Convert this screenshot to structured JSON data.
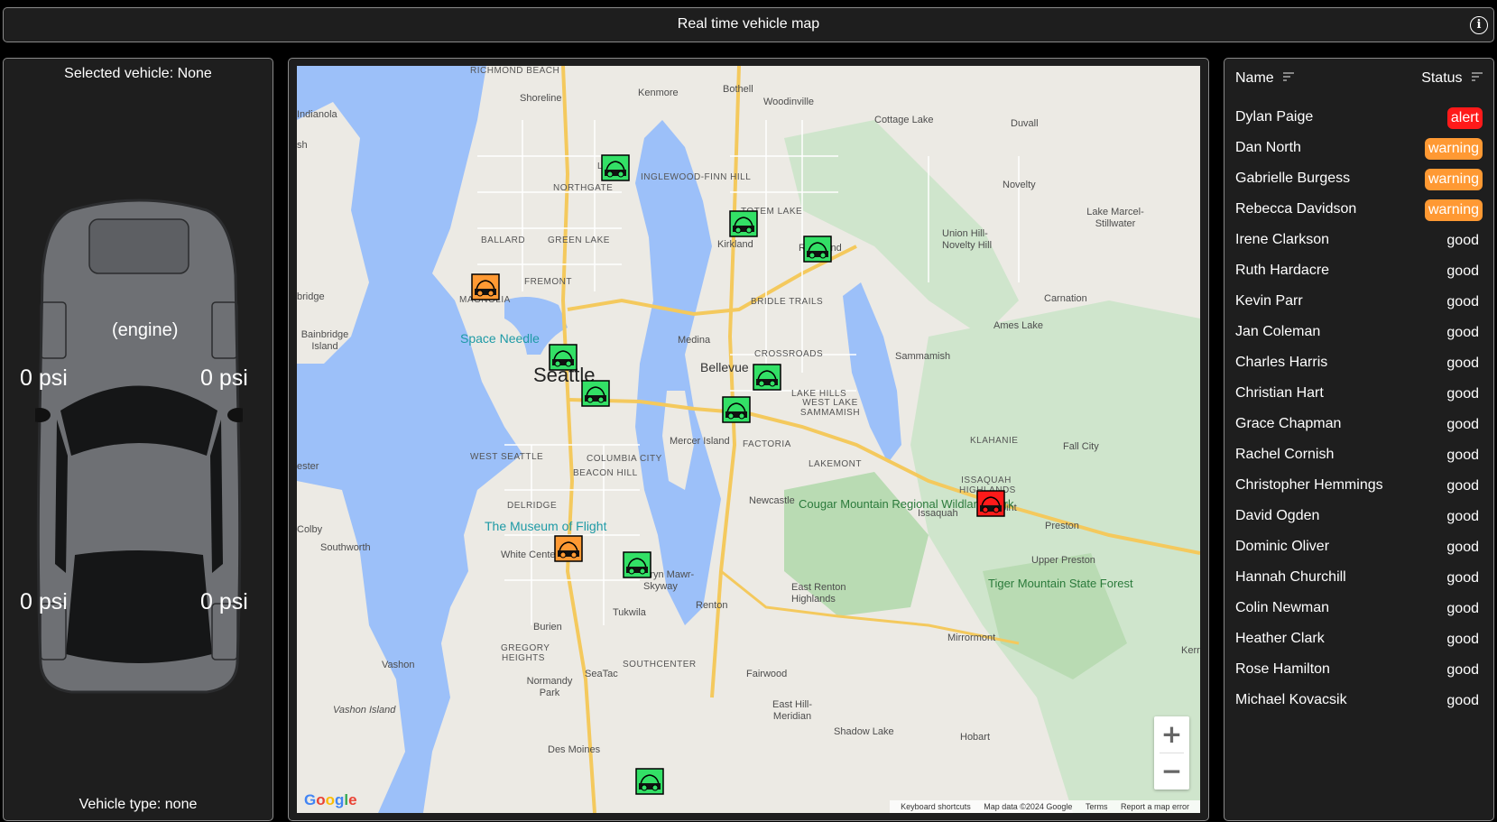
{
  "header": {
    "title": "Real time vehicle map",
    "info_label": "i"
  },
  "left_panel": {
    "selected_vehicle": "Selected vehicle: None",
    "engine_label": "(engine)",
    "tires": {
      "front_left": "0 psi",
      "front_right": "0 psi",
      "rear_left": "0 psi",
      "rear_right": "0 psi"
    },
    "vehicle_type": "Vehicle type: none"
  },
  "map": {
    "places": {
      "richmond_beach": "RICHMOND BEACH",
      "shoreline": "Shoreline",
      "kenmore": "Kenmore",
      "bothell": "Bothell",
      "woodinville": "Woodinville",
      "cottage_lake": "Cottage Lake",
      "duvall": "Duvall",
      "indianola": "Indianola",
      "lake_city": "LAKE",
      "northgate": "NORTHGATE",
      "inglewood": "INGLEWOOD-FINN HILL",
      "totem_lake": "TOTEM LAKE",
      "novelty": "Novelty",
      "kirkland": "Kirkland",
      "redmond": "Redmond",
      "union_hill": "Union Hill-Novelty Hill",
      "lake_marcel": "Lake Marcel-Stillwater",
      "ballard": "BALLARD",
      "green_lake": "GREEN LAKE",
      "fremont": "FREMONT",
      "magnolia": "MAGNOLIA",
      "bridle_trails": "BRIDLE TRAILS",
      "carnation": "Carnation",
      "bainbridge": "Bainbridge Island",
      "space_needle": "Space Needle",
      "medina": "Medina",
      "ames_lake": "Ames Lake",
      "sammamish": "Sammamish",
      "seattle": "Seattle",
      "bellevue": "Bellevue",
      "crossroads": "CROSSROADS",
      "lake_hills": "LAKE HILLS",
      "west_lake_sammamish": "WEST LAKE SAMMAMISH",
      "mercer_island": "Mercer Island",
      "factoria": "FACTORIA",
      "klahanie": "KLAHANIE",
      "fall_city": "Fall City",
      "west_seattle": "WEST SEATTLE",
      "columbia_city": "COLUMBIA CITY",
      "beacon_hill": "BEACON HILL",
      "lakemont": "LAKEMONT",
      "issaquah_highlands": "ISSAQUAH HIGHLANDS",
      "delridge": "DELRIDGE",
      "newcastle": "Newcastle",
      "issaquah": "Issaquah",
      "snoqualmie_point": "Point",
      "preston": "Preston",
      "museum_of_flight": "The Museum of Flight",
      "cougar_mountain": "Cougar Mountain Regional Wildland Park",
      "colby": "Colby",
      "southworth": "Southworth",
      "white_center": "White Center",
      "upper_preston": "Upper Preston",
      "bryn_mawr": "Bryn Mawr-Skyway",
      "renton": "Renton",
      "east_renton": "East Renton Highlands",
      "tiger_mountain": "Tiger Mountain State Forest",
      "burien": "Burien",
      "tukwila": "Tukwila",
      "gregory_heights": "GREGORY HEIGHTS",
      "mirrormont": "Mirrormont",
      "vashon": "Vashon",
      "southcenter": "SOUTHCENTER",
      "seatac": "SeaTac",
      "fairwood": "Fairwood",
      "normandy_park": "Normandy Park",
      "vashon_island": "Vashon Island",
      "east_hill": "East Hill-Meridian",
      "shadow_lake": "Shadow Lake",
      "hobart": "Hobart",
      "des_moines": "Des Moines",
      "bridge_island": "bridge",
      "ester": "ester",
      "sh": "sh",
      "kerris": "Kerris",
      "seattle_point": "oint"
    },
    "zoom_in": "+",
    "zoom_out": "−",
    "google_logo": "Google",
    "attribution": {
      "shortcuts": "Keyboard shortcuts",
      "data": "Map data ©2024 Google",
      "terms": "Terms",
      "report": "Report a map error"
    },
    "markers": [
      {
        "status": "good"
      },
      {
        "status": "good"
      },
      {
        "status": "good"
      },
      {
        "status": "warning"
      },
      {
        "status": "good"
      },
      {
        "status": "good"
      },
      {
        "status": "good"
      },
      {
        "status": "good"
      },
      {
        "status": "warning"
      },
      {
        "status": "good"
      },
      {
        "status": "alert"
      },
      {
        "status": "good"
      }
    ]
  },
  "vehicle_list": {
    "name_header": "Name",
    "status_header": "Status",
    "rows": [
      {
        "name": "Dylan Paige",
        "status": "alert"
      },
      {
        "name": "Dan North",
        "status": "warning"
      },
      {
        "name": "Gabrielle Burgess",
        "status": "warning"
      },
      {
        "name": "Rebecca Davidson",
        "status": "warning"
      },
      {
        "name": "Irene Clarkson",
        "status": "good"
      },
      {
        "name": "Ruth Hardacre",
        "status": "good"
      },
      {
        "name": "Kevin Parr",
        "status": "good"
      },
      {
        "name": "Jan Coleman",
        "status": "good"
      },
      {
        "name": "Charles Harris",
        "status": "good"
      },
      {
        "name": "Christian Hart",
        "status": "good"
      },
      {
        "name": "Grace Chapman",
        "status": "good"
      },
      {
        "name": "Rachel Cornish",
        "status": "good"
      },
      {
        "name": "Christopher Hemmings",
        "status": "good"
      },
      {
        "name": "David Ogden",
        "status": "good"
      },
      {
        "name": "Dominic Oliver",
        "status": "good"
      },
      {
        "name": "Hannah Churchill",
        "status": "good"
      },
      {
        "name": "Colin Newman",
        "status": "good"
      },
      {
        "name": "Heather Clark",
        "status": "good"
      },
      {
        "name": "Rose Hamilton",
        "status": "good"
      },
      {
        "name": "Michael Kovacsik",
        "status": "good"
      }
    ]
  },
  "colors": {
    "alert": "#ff1a1a",
    "warning": "#ff9933",
    "good": "#33e066",
    "panel_bg": "#1e1e1e",
    "water": "#9cc0f9"
  }
}
